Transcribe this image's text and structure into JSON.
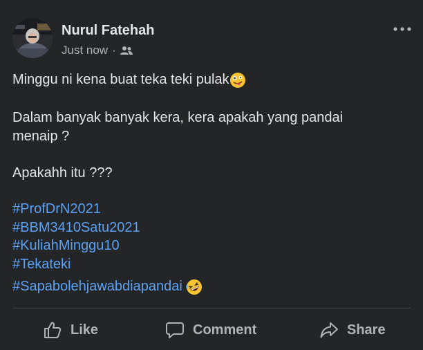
{
  "post": {
    "author": "Nurul Fatehah",
    "time": "Just now",
    "separator": "·",
    "audience_icon": "friends-icon",
    "lines": [
      "Minggu ni kena buat teka teki pulak",
      "Dalam banyak banyak kera, kera apakah yang pandai",
      "menaip ?",
      "Apakahh itu ???"
    ],
    "line1_emoji": "zany-face-emoji",
    "hashtags": [
      "#ProfDrN2021",
      "#BBM3410Satu2021",
      "#KuliahMinggu10",
      "#Tekateki",
      "#Sapabolehjawabdiapandai"
    ],
    "last_hashtag_emoji": "rofl-emoji"
  },
  "actions": {
    "like": "Like",
    "comment": "Comment",
    "share": "Share"
  },
  "colors": {
    "background": "#242526",
    "text": "#e4e6eb",
    "secondary": "#b0b3b8",
    "hashtag": "#5aa0f5"
  }
}
